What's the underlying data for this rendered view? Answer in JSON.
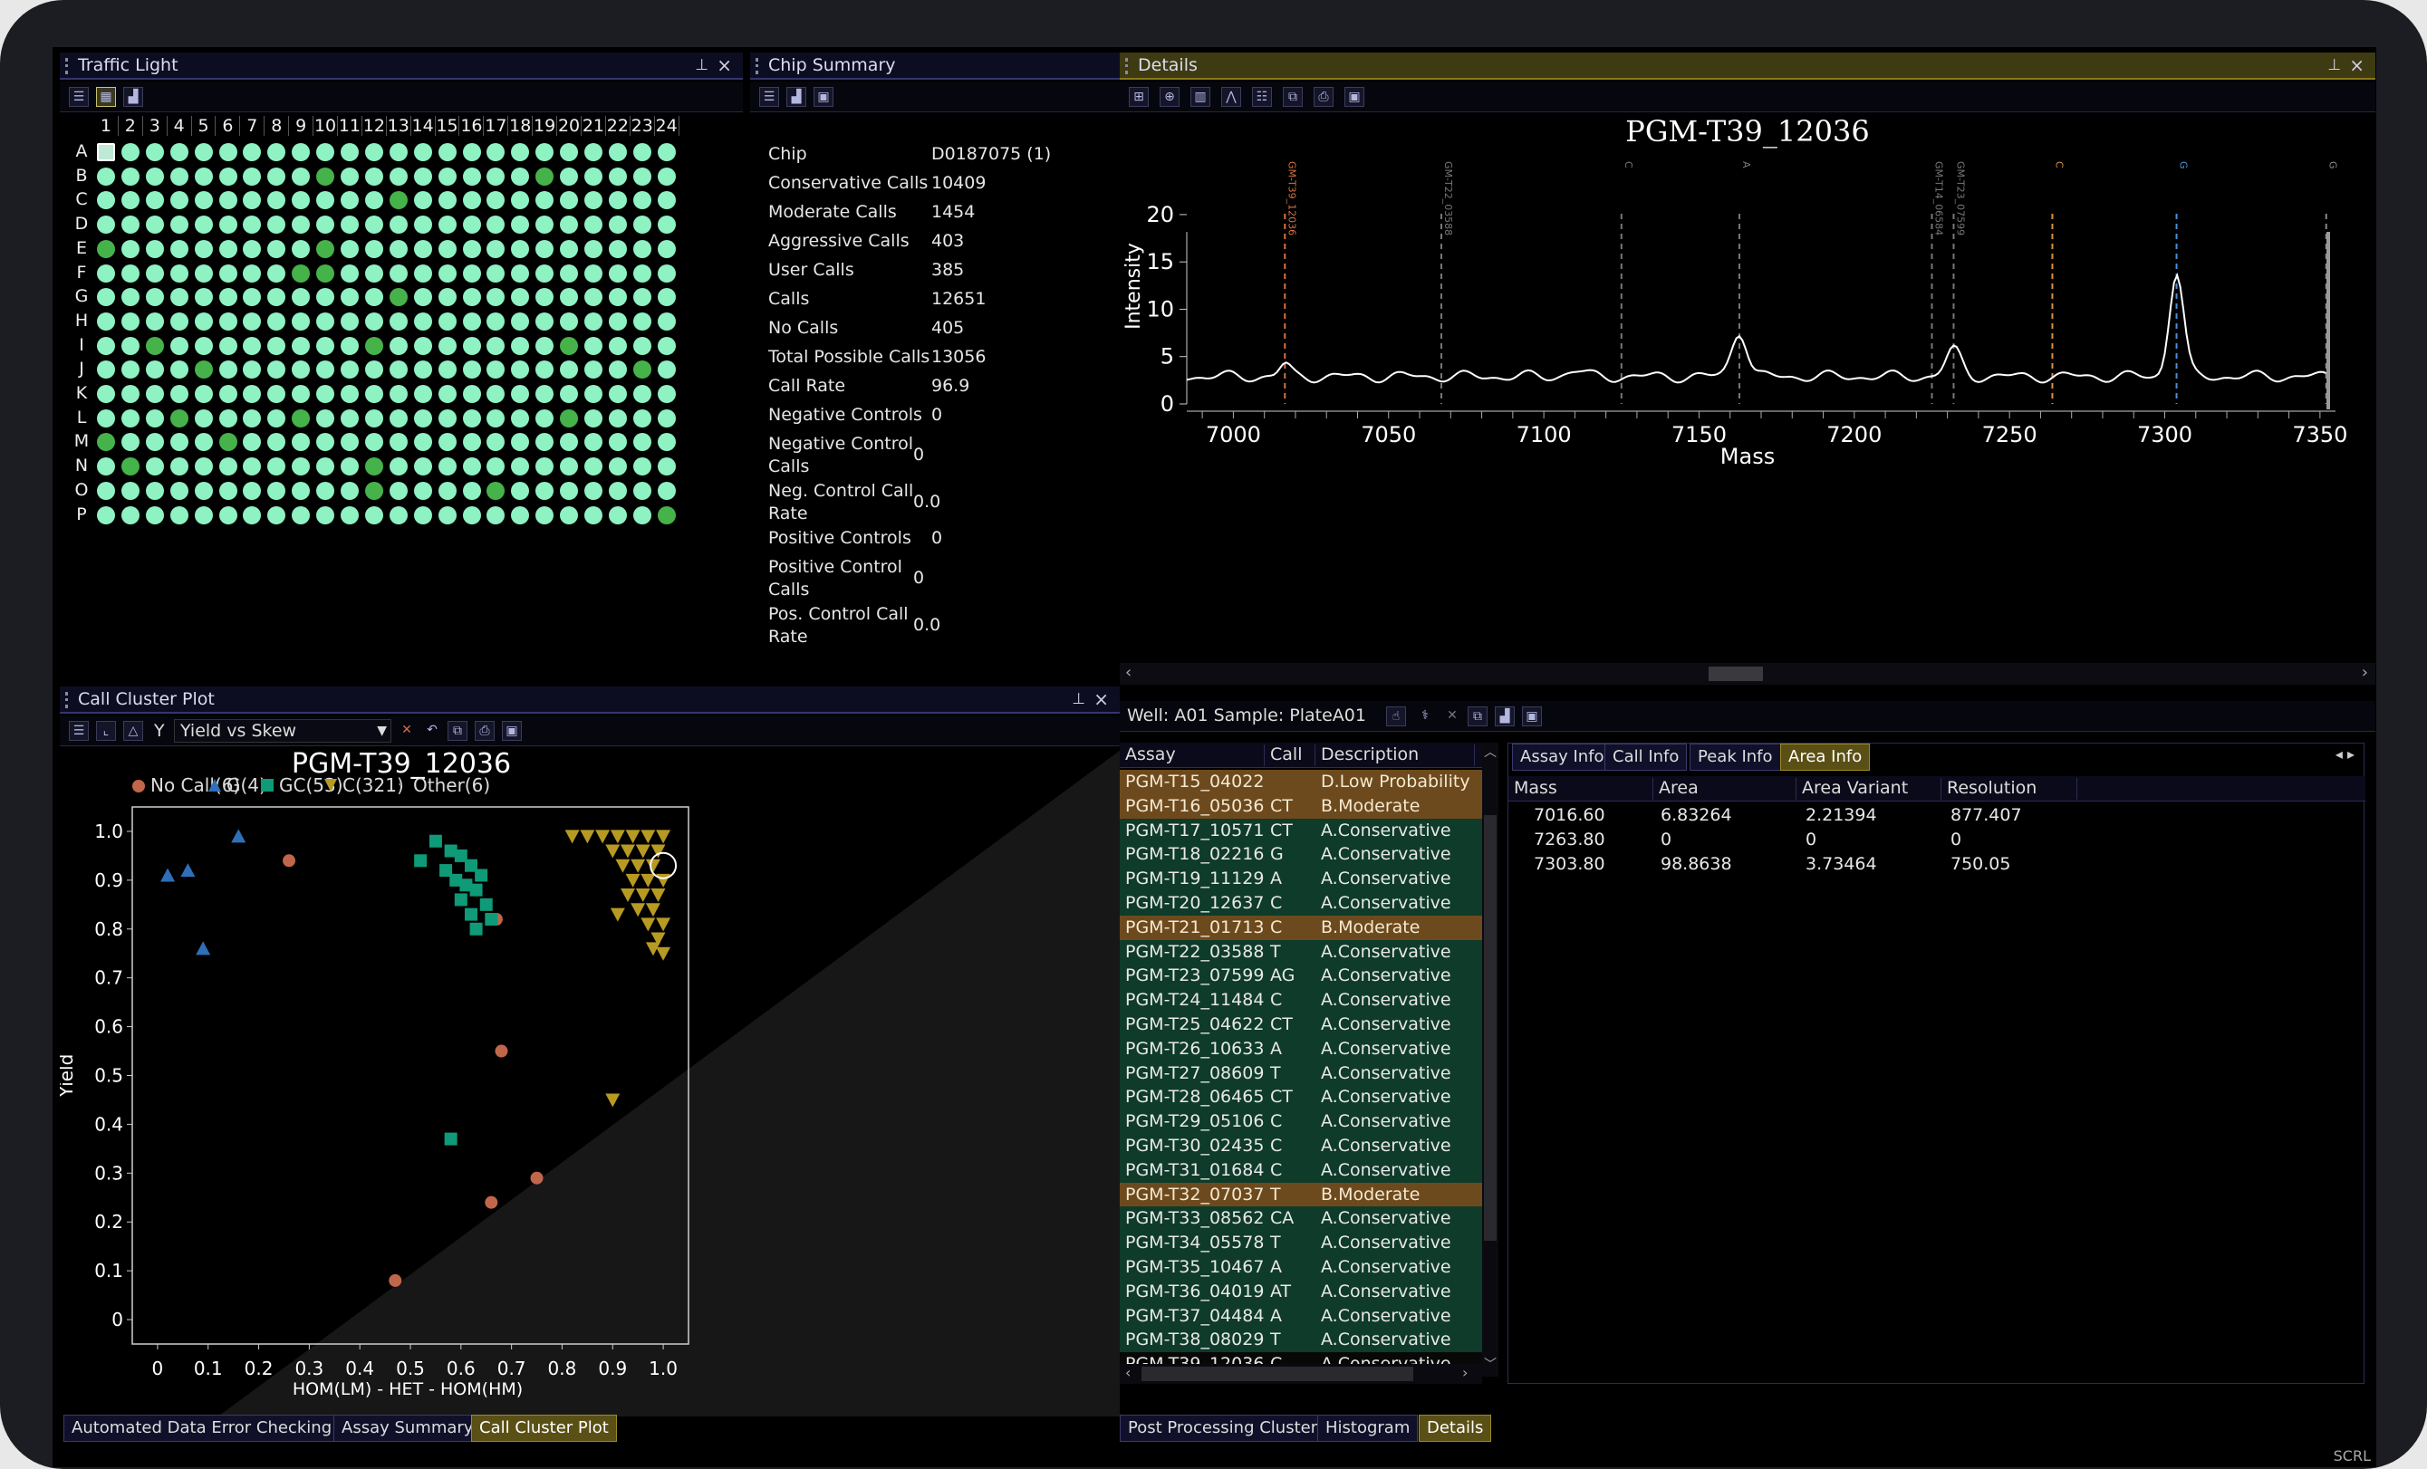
{
  "traffic_light": {
    "title": "Traffic Light",
    "columns": [
      "1",
      "2",
      "3",
      "4",
      "5",
      "6",
      "7",
      "8",
      "9",
      "10",
      "11",
      "12",
      "13",
      "14",
      "15",
      "16",
      "17",
      "18",
      "19",
      "20",
      "21",
      "22",
      "23",
      "24"
    ],
    "rows": [
      "A",
      "B",
      "C",
      "D",
      "E",
      "F",
      "G",
      "H",
      "I",
      "J",
      "K",
      "L",
      "M",
      "N",
      "O",
      "P"
    ]
  },
  "chip_summary": {
    "title": "Chip Summary",
    "rows": [
      {
        "label": "Chip",
        "value": "D0187075 (1)"
      },
      {
        "label": "Conservative Calls",
        "value": "10409"
      },
      {
        "label": "Moderate Calls",
        "value": "1454"
      },
      {
        "label": "Aggressive Calls",
        "value": "403"
      },
      {
        "label": "User Calls",
        "value": "385"
      },
      {
        "label": "Calls",
        "value": "12651"
      },
      {
        "label": "No Calls",
        "value": "405"
      },
      {
        "label": "Total Possible Calls",
        "value": "13056"
      },
      {
        "label": "Call Rate",
        "value": "96.9"
      },
      {
        "label": "Negative Controls",
        "value": "0"
      },
      {
        "label": "Negative Control Calls",
        "value": "0"
      },
      {
        "label": "Neg. Control Call Rate",
        "value": "0.0"
      },
      {
        "label": "Positive Controls",
        "value": "0"
      },
      {
        "label": "Positive Control Calls",
        "value": "0"
      },
      {
        "label": "Pos. Control Call Rate",
        "value": "0.0"
      }
    ]
  },
  "details": {
    "title": "Details",
    "spectrum_title": "PGM-T39_12036",
    "xlabel": "Mass",
    "ylabel": "Intensity",
    "x_ticks": [
      "7000",
      "7050",
      "7100",
      "7150",
      "7200",
      "7250",
      "7300",
      "7350"
    ],
    "y_ticks": [
      "0",
      "5",
      "10",
      "15",
      "20"
    ],
    "marker_labels": [
      "GM-T39_12036",
      "GM-T22_03588",
      "C",
      "A",
      "GM-T14_06584",
      "GM-T23_07599",
      "C",
      "G",
      "G"
    ]
  },
  "cluster": {
    "title": "Call Cluster Plot",
    "view_select": "Yield vs Skew",
    "y_label_btn": "Y",
    "plot_title": "PGM-T39_12036",
    "legend": [
      {
        "label": "No Call(6)",
        "shape": "circle",
        "color": "#c0674b"
      },
      {
        "label": "G(4)",
        "shape": "triangle-up",
        "color": "#2f6fb7"
      },
      {
        "label": "GC(53)",
        "shape": "square",
        "color": "#0f9a78"
      },
      {
        "label": "C(321)",
        "shape": "triangle-down",
        "color": "#b79a22"
      },
      {
        "label": "Other(6)",
        "shape": "dot",
        "color": "#999999"
      }
    ],
    "ylabel": "Yield",
    "xlabel": "HOM(LM)   -   HET   -   HOM(HM)",
    "x_ticks": [
      "0",
      "0.1",
      "0.2",
      "0.3",
      "0.4",
      "0.5",
      "0.6",
      "0.7",
      "0.8",
      "0.9",
      "1.0"
    ],
    "y_ticks": [
      "0",
      "0.1",
      "0.2",
      "0.3",
      "0.4",
      "0.5",
      "0.6",
      "0.7",
      "0.8",
      "0.9",
      "1.0"
    ]
  },
  "chart_data": {
    "type": "scatter",
    "title": "PGM-T39_12036",
    "xlabel": "HOM(LM) - HET - HOM(HM)",
    "ylabel": "Yield",
    "xlim": [
      -0.05,
      1.05
    ],
    "ylim": [
      -0.05,
      1.05
    ],
    "grid": false,
    "legend_placement": "top",
    "series": [
      {
        "name": "No Call(6)",
        "points": [
          [
            0.26,
            0.94
          ],
          [
            0.67,
            0.82
          ],
          [
            0.68,
            0.55
          ],
          [
            0.75,
            0.29
          ],
          [
            0.66,
            0.24
          ],
          [
            0.47,
            0.08
          ]
        ]
      },
      {
        "name": "G(4)",
        "points": [
          [
            0.02,
            0.91
          ],
          [
            0.06,
            0.92
          ],
          [
            0.16,
            0.99
          ],
          [
            0.09,
            0.76
          ]
        ]
      },
      {
        "name": "GC(53)",
        "points": [
          [
            0.55,
            0.98
          ],
          [
            0.58,
            0.96
          ],
          [
            0.6,
            0.95
          ],
          [
            0.62,
            0.93
          ],
          [
            0.57,
            0.92
          ],
          [
            0.59,
            0.9
          ],
          [
            0.61,
            0.89
          ],
          [
            0.64,
            0.91
          ],
          [
            0.63,
            0.88
          ],
          [
            0.6,
            0.86
          ],
          [
            0.65,
            0.85
          ],
          [
            0.62,
            0.83
          ],
          [
            0.66,
            0.82
          ],
          [
            0.63,
            0.8
          ],
          [
            0.52,
            0.94
          ],
          [
            0.58,
            0.37
          ]
        ]
      },
      {
        "name": "C(321)",
        "points": [
          [
            0.82,
            0.99
          ],
          [
            0.85,
            0.99
          ],
          [
            0.88,
            0.99
          ],
          [
            0.91,
            0.99
          ],
          [
            0.94,
            0.99
          ],
          [
            0.97,
            0.99
          ],
          [
            1.0,
            0.99
          ],
          [
            0.9,
            0.96
          ],
          [
            0.93,
            0.96
          ],
          [
            0.96,
            0.96
          ],
          [
            0.99,
            0.96
          ],
          [
            0.92,
            0.93
          ],
          [
            0.95,
            0.93
          ],
          [
            0.98,
            0.93
          ],
          [
            0.94,
            0.9
          ],
          [
            0.97,
            0.9
          ],
          [
            1.0,
            0.9
          ],
          [
            0.93,
            0.87
          ],
          [
            0.96,
            0.87
          ],
          [
            0.99,
            0.87
          ],
          [
            0.95,
            0.84
          ],
          [
            0.98,
            0.84
          ],
          [
            0.91,
            0.83
          ],
          [
            0.97,
            0.81
          ],
          [
            1.0,
            0.81
          ],
          [
            0.99,
            0.78
          ],
          [
            1.0,
            0.75
          ],
          [
            0.98,
            0.76
          ],
          [
            0.9,
            0.45
          ]
        ]
      },
      {
        "name": "Other(6)",
        "points": []
      }
    ]
  },
  "well_bar": {
    "label": "Well: A01 Sample: PlateA01"
  },
  "assay_table": {
    "headers": [
      "Assay",
      "Call",
      "Description"
    ],
    "rows": [
      {
        "assay": "PGM-T15_04022",
        "call": "",
        "desc": "D.Low Probability",
        "hl": "orange"
      },
      {
        "assay": "PGM-T16_05036",
        "call": "CT",
        "desc": "B.Moderate",
        "hl": "orange"
      },
      {
        "assay": "PGM-T17_10571",
        "call": "CT",
        "desc": "A.Conservative",
        "hl": "green"
      },
      {
        "assay": "PGM-T18_02216",
        "call": "G",
        "desc": "A.Conservative",
        "hl": "green"
      },
      {
        "assay": "PGM-T19_11129",
        "call": "A",
        "desc": "A.Conservative",
        "hl": "green"
      },
      {
        "assay": "PGM-T20_12637",
        "call": "C",
        "desc": "A.Conservative",
        "hl": "green"
      },
      {
        "assay": "PGM-T21_01713",
        "call": "C",
        "desc": "B.Moderate",
        "hl": "orange"
      },
      {
        "assay": "PGM-T22_03588",
        "call": "T",
        "desc": "A.Conservative",
        "hl": "green"
      },
      {
        "assay": "PGM-T23_07599",
        "call": "AG",
        "desc": "A.Conservative",
        "hl": "green"
      },
      {
        "assay": "PGM-T24_11484",
        "call": "C",
        "desc": "A.Conservative",
        "hl": "green"
      },
      {
        "assay": "PGM-T25_04622",
        "call": "CT",
        "desc": "A.Conservative",
        "hl": "green"
      },
      {
        "assay": "PGM-T26_10633",
        "call": "A",
        "desc": "A.Conservative",
        "hl": "green"
      },
      {
        "assay": "PGM-T27_08609",
        "call": "T",
        "desc": "A.Conservative",
        "hl": "green"
      },
      {
        "assay": "PGM-T28_06465",
        "call": "CT",
        "desc": "A.Conservative",
        "hl": "green"
      },
      {
        "assay": "PGM-T29_05106",
        "call": "C",
        "desc": "A.Conservative",
        "hl": "green"
      },
      {
        "assay": "PGM-T30_02435",
        "call": "C",
        "desc": "A.Conservative",
        "hl": "green"
      },
      {
        "assay": "PGM-T31_01684",
        "call": "C",
        "desc": "A.Conservative",
        "hl": "green"
      },
      {
        "assay": "PGM-T32_07037",
        "call": "T",
        "desc": "B.Moderate",
        "hl": "orange"
      },
      {
        "assay": "PGM-T33_08562",
        "call": "CA",
        "desc": "A.Conservative",
        "hl": "green"
      },
      {
        "assay": "PGM-T34_05578",
        "call": "T",
        "desc": "A.Conservative",
        "hl": "green"
      },
      {
        "assay": "PGM-T35_10467",
        "call": "A",
        "desc": "A.Conservative",
        "hl": "green"
      },
      {
        "assay": "PGM-T36_04019",
        "call": "AT",
        "desc": "A.Conservative",
        "hl": "green"
      },
      {
        "assay": "PGM-T37_04484",
        "call": "A",
        "desc": "A.Conservative",
        "hl": "green"
      },
      {
        "assay": "PGM-T38_08029",
        "call": "T",
        "desc": "A.Conservative",
        "hl": "green"
      },
      {
        "assay": "PGM-T39_12036",
        "call": "C",
        "desc": "A.Conservative",
        "hl": "selected"
      }
    ]
  },
  "info_tabs": [
    {
      "label": "Assay Info"
    },
    {
      "label": "Call Info"
    },
    {
      "label": "Peak Info"
    },
    {
      "label": "Area Info",
      "active": true
    }
  ],
  "area_table": {
    "headers": [
      "Mass",
      "Area",
      "Area Variant",
      "Resolution"
    ],
    "rows": [
      [
        "7016.60",
        "6.83264",
        "2.21394",
        "877.407"
      ],
      [
        "7263.80",
        "0",
        "0",
        "0"
      ],
      [
        "7303.80",
        "98.8638",
        "3.73464",
        "750.05"
      ]
    ]
  },
  "bottom_tabs_left": [
    {
      "label": "Automated Data Error Checking"
    },
    {
      "label": "Assay Summary"
    },
    {
      "label": "Call Cluster Plot",
      "active": true
    }
  ],
  "bottom_tabs_right": [
    {
      "label": "Post Processing Clusters"
    },
    {
      "label": "Histogram"
    },
    {
      "label": "Details",
      "active": true
    }
  ],
  "status": {
    "scrl": "SCRL"
  }
}
